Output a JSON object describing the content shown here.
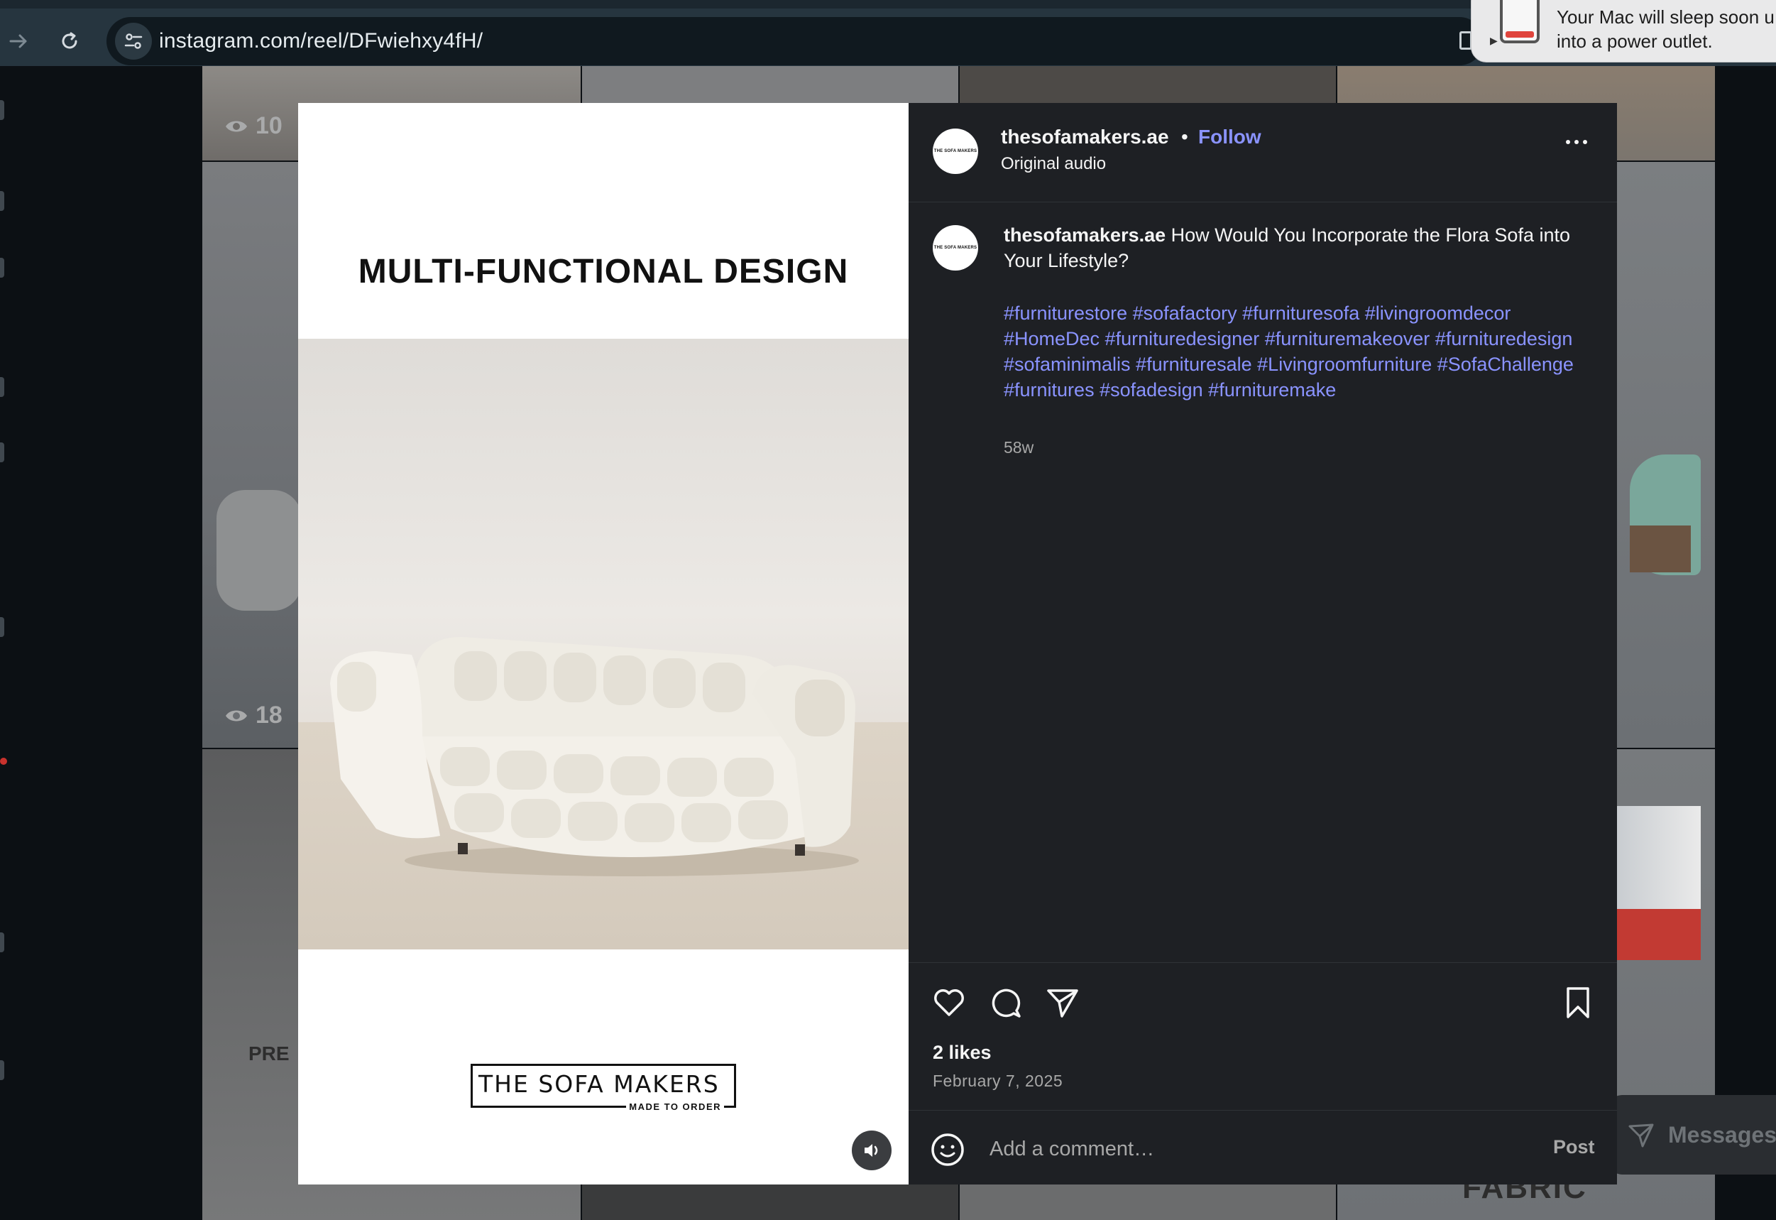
{
  "browser": {
    "url": "instagram.com/reel/DFwiehxy4fH/"
  },
  "notification": {
    "text": "Your Mac will sleep soon u\ninto a power outlet."
  },
  "background": {
    "view_counts": [
      "10",
      "18"
    ],
    "tile_text_left": "PRE",
    "tile_text_bottom": "FABRIC",
    "messages_label": "Messages"
  },
  "media": {
    "headline": "MULTI-FUNCTIONAL DESIGN",
    "logo_main": "THE SOFA MAKERS",
    "logo_sub": "MADE TO ORDER",
    "avatar_text": "THE SOFA MAKERS"
  },
  "post": {
    "username": "thesofamakers.ae",
    "separator": "•",
    "follow_label": "Follow",
    "audio_label": "Original audio",
    "caption_user": "thesofamakers.ae",
    "caption_text": "How Would You Incorporate the Flora Sofa into Your Lifestyle?",
    "hashtags": "#furniturestore #sofafactory #furnituresofa #livingroomdecor #HomeDec #furnituredesigner #furnituremakeover #furnituredesign #sofaminimalis #furnituresale #Livingroomfurniture #SofaChallenge #furnitures #sofadesign #furnituremake",
    "age": "58w",
    "likes": "2 likes",
    "date": "February 7, 2025",
    "comment_placeholder": "Add a comment…",
    "post_label": "Post"
  },
  "colors": {
    "accent_link": "#8a93ff",
    "panel_bg": "#1e2024",
    "page_bg": "#0c1014"
  }
}
